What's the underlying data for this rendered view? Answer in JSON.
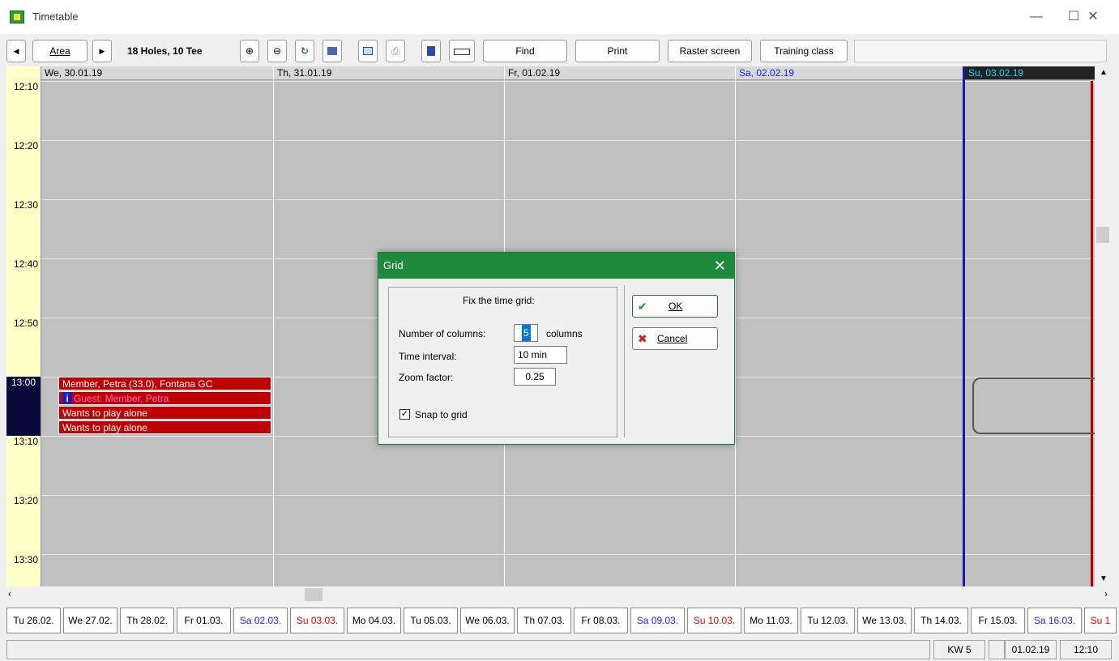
{
  "window": {
    "title": "Timetable",
    "minimize": "—",
    "maximize": "☐",
    "close": "✕"
  },
  "toolbar": {
    "prev": "◀",
    "area": "Area",
    "next": "▶",
    "course": "18 Holes, 10 Tee",
    "zoom_in": "⊕",
    "zoom_out": "⊖",
    "refresh": "↻",
    "find": "Find",
    "print": "Print",
    "raster": "Raster screen",
    "training": "Training class"
  },
  "times": [
    "12:10",
    "12:20",
    "12:30",
    "12:40",
    "12:50",
    "13:00",
    "13:10",
    "13:20",
    "13:30"
  ],
  "current_time": "13:00",
  "days": [
    {
      "label": "We, 30.01.19",
      "color": "#000000"
    },
    {
      "label": "Th, 31.01.19",
      "color": "#000000"
    },
    {
      "label": "Fr, 01.02.19",
      "color": "#000000"
    },
    {
      "label": "Sa, 02.02.19",
      "color": "#1a1aff"
    },
    {
      "label": "Su, 03.02.19",
      "color": "#00e0ff"
    }
  ],
  "bookings": [
    "Member, Petra (33.0), Fontana GC",
    "Guest: Member, Petra",
    "Wants to play alone",
    "Wants to play alone"
  ],
  "date_strip": [
    {
      "label": "Tu 26.02.",
      "color": "#000000"
    },
    {
      "label": "We 27.02.",
      "color": "#000000"
    },
    {
      "label": "Th 28.02.",
      "color": "#000000"
    },
    {
      "label": "Fr 01.03.",
      "color": "#000000"
    },
    {
      "label": "Sa 02.03.",
      "color": "#1a1aff"
    },
    {
      "label": "Su 03.03.",
      "color": "#e00000"
    },
    {
      "label": "Mo 04.03.",
      "color": "#000000"
    },
    {
      "label": "Tu 05.03.",
      "color": "#000000"
    },
    {
      "label": "We 06.03.",
      "color": "#000000"
    },
    {
      "label": "Th 07.03.",
      "color": "#000000"
    },
    {
      "label": "Fr 08.03.",
      "color": "#000000"
    },
    {
      "label": "Sa 09.03.",
      "color": "#1a1aff"
    },
    {
      "label": "Su 10.03.",
      "color": "#e00000"
    },
    {
      "label": "Mo 11.03.",
      "color": "#000000"
    },
    {
      "label": "Tu 12.03.",
      "color": "#000000"
    },
    {
      "label": "We 13.03.",
      "color": "#000000"
    },
    {
      "label": "Th 14.03.",
      "color": "#000000"
    },
    {
      "label": "Fr 15.03.",
      "color": "#000000"
    },
    {
      "label": "Sa 16.03.",
      "color": "#1a1aff"
    },
    {
      "label": "Su 1",
      "color": "#e00000"
    }
  ],
  "status": {
    "week": "KW 5",
    "date": "01.02.19",
    "time": "12:10"
  },
  "dialog": {
    "title": "Grid",
    "close": "✕",
    "heading": "Fix the time grid:",
    "columns_label": "Number of columns:",
    "columns_value": "5",
    "columns_unit": "columns",
    "interval_label": "Time interval:",
    "interval_value": "10 min",
    "zoom_label": "Zoom factor:",
    "zoom_value": "0.25",
    "snap_label": "Snap to grid",
    "snap_mark": "✓",
    "ok": "OK",
    "ok_icon": "✔",
    "cancel": "Cancel",
    "cancel_icon": "✖",
    "accent": "#1e8a3c"
  }
}
